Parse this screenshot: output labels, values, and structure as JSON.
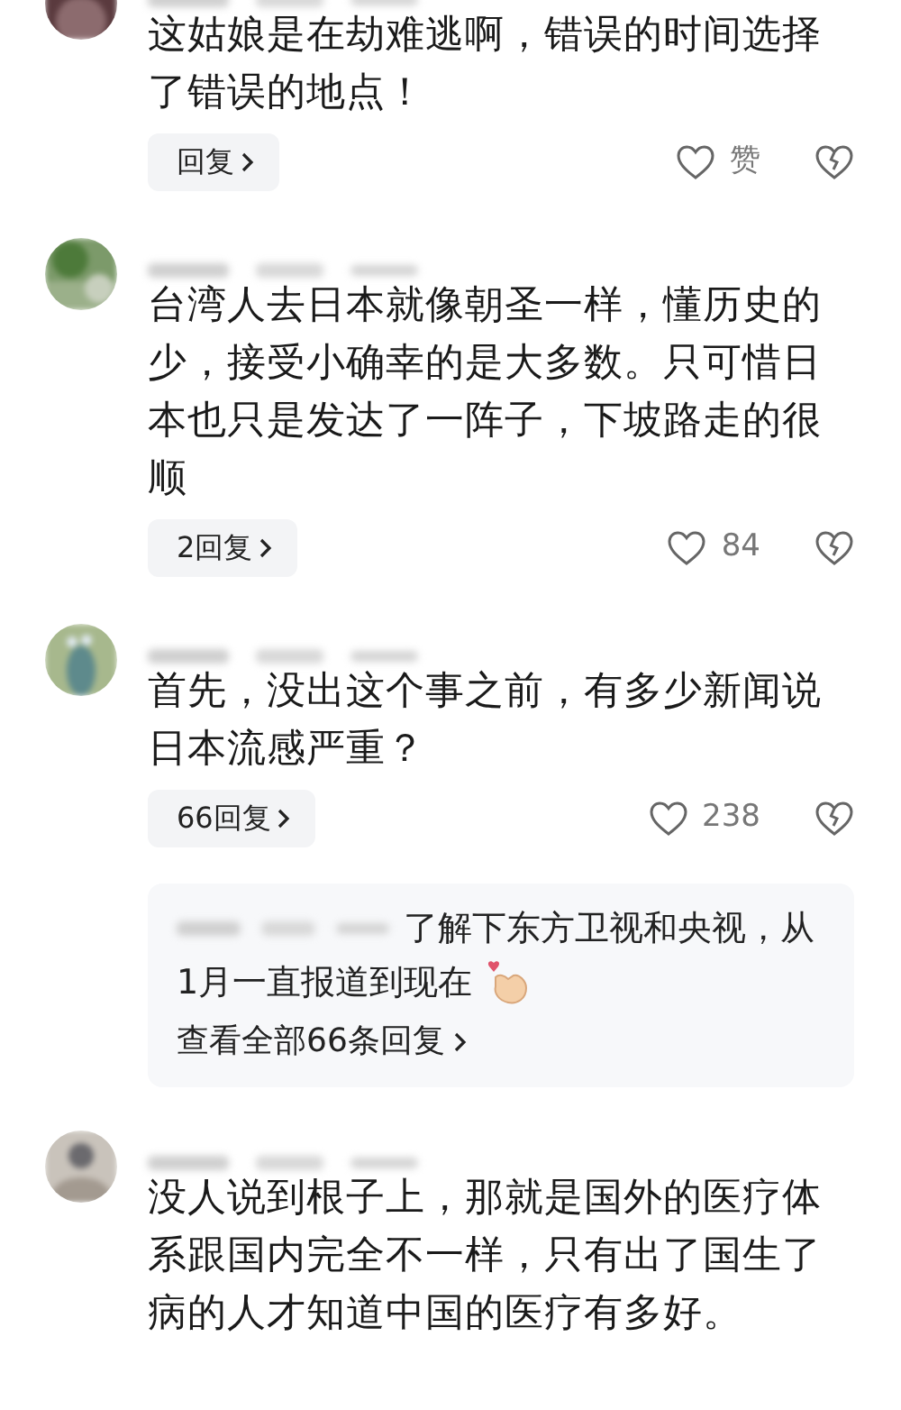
{
  "comments": [
    {
      "text": "这姑娘是在劫难逃啊，错误的时间选择了错误的地点！",
      "reply_button": "回复",
      "likes": "赞"
    },
    {
      "text": "台湾人去日本就像朝圣一样，懂历史的少，接受小确幸的是大多数。只可惜日本也只是发达了一阵子，下坡路走的很顺",
      "reply_button": "2回复",
      "likes": "84"
    },
    {
      "text": "首先，没出这个事之前，有多少新闻说日本流感严重？",
      "reply_button": "66回复",
      "likes": "238",
      "reply_preview": {
        "text_lines": [
          "了解下东方卫视和央视，从",
          "1月一直报道到现在"
        ],
        "view_all": "查看全部66条回复"
      }
    },
    {
      "text": "没人说到根子上，那就是国外的医疗体系跟国内完全不一样，只有出了国生了病的人才知道中国的医疗有多好。"
    }
  ]
}
